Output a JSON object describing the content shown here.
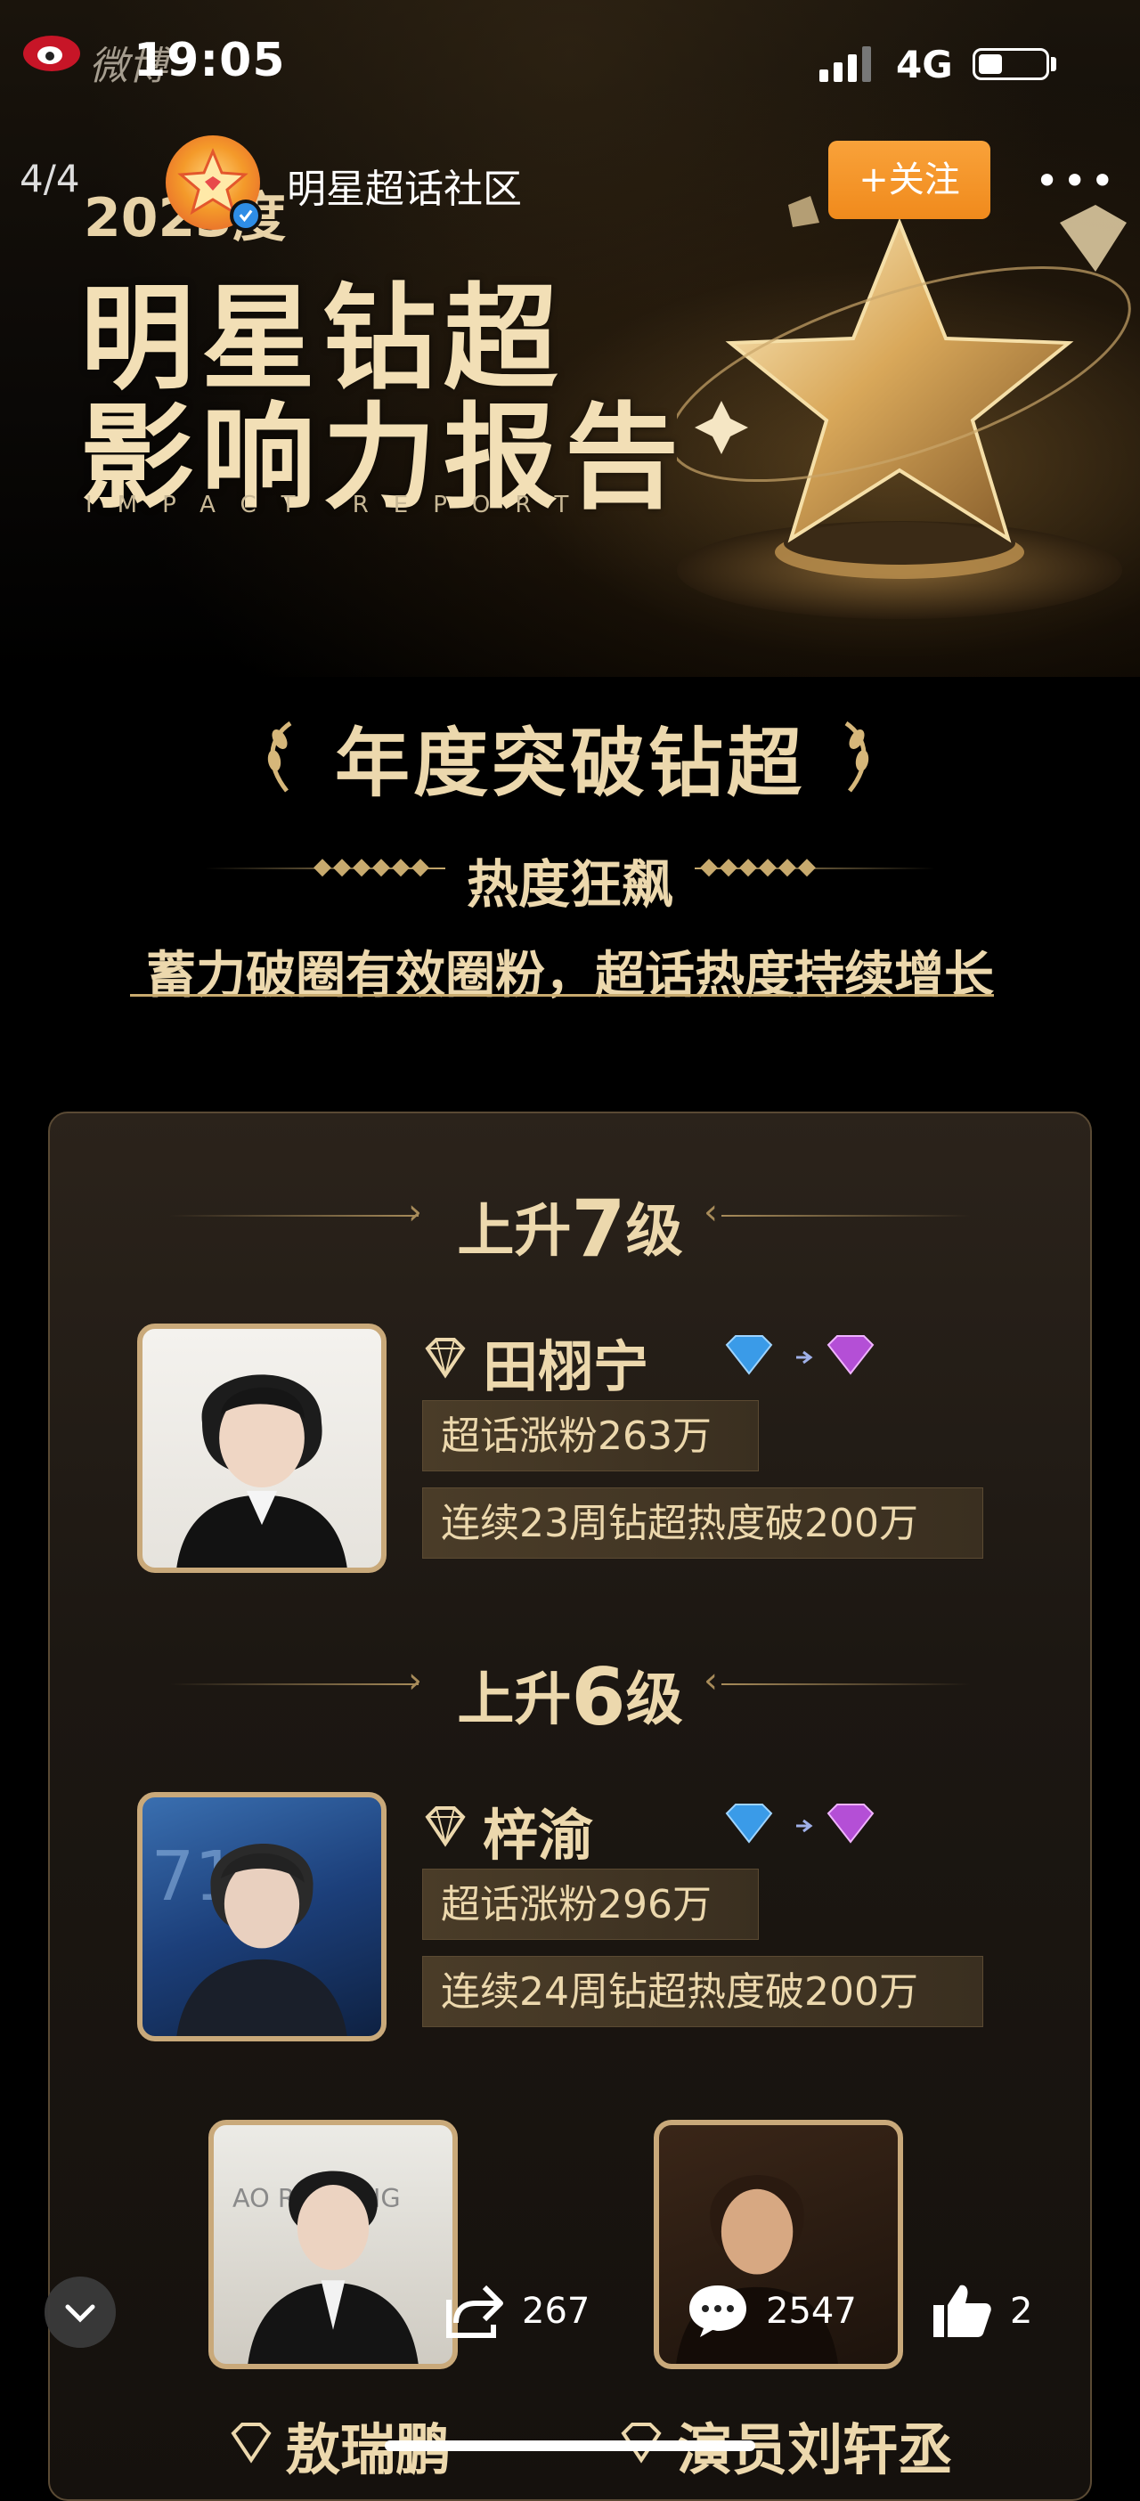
{
  "status_bar": {
    "app_watermark": "微博",
    "time": "19:05",
    "network": "4G"
  },
  "header": {
    "page_indicator": "4/4",
    "account_name": "明星超话社区",
    "follow_label": "+关注",
    "more_label": "•••"
  },
  "banner": {
    "year": "2023度",
    "title_line1": "明星钻超",
    "title_line2": "影响力报告",
    "subtitle": "IMPACT REPORT"
  },
  "section": {
    "title": "年度突破钻超",
    "subtitle": "热度狂飙",
    "tagline": "蓄力破圈有效圈粉，超话热度持续增长"
  },
  "rank_groups": [
    {
      "prefix": "上升",
      "number": "7",
      "suffix": "级",
      "star": {
        "name": "田栩宁",
        "level_from": "2",
        "level_to": "3",
        "stats": [
          "超话涨粉263万",
          "连续23周钻超热度破200万"
        ]
      }
    },
    {
      "prefix": "上升",
      "number": "6",
      "suffix": "级",
      "star": {
        "name": "梓渝",
        "level_from": "3",
        "level_to": "3",
        "stats": [
          "超话涨粉296万",
          "连续24周钻超热度破200万"
        ]
      }
    }
  ],
  "bottom_stars": [
    {
      "name": "敖瑞鹏",
      "photo_text": "AO RUI PENG"
    },
    {
      "name": "演员刘轩丞",
      "photo_text": ""
    }
  ],
  "actions": {
    "share_count": "267",
    "comment_count": "2547",
    "like_count": "2"
  },
  "colors": {
    "gold_text": "#ecd8ad",
    "follow_button": "#f39523",
    "card_border": "#5a4a34"
  },
  "icons": [
    "weibo-logo-icon",
    "signal-icon",
    "battery-icon",
    "star-avatar-icon",
    "verified-icon",
    "more-icon",
    "laurel-icon",
    "diamond-icon",
    "level-gem-icon",
    "chevron-down-icon",
    "share-icon",
    "comment-icon",
    "like-icon"
  ]
}
